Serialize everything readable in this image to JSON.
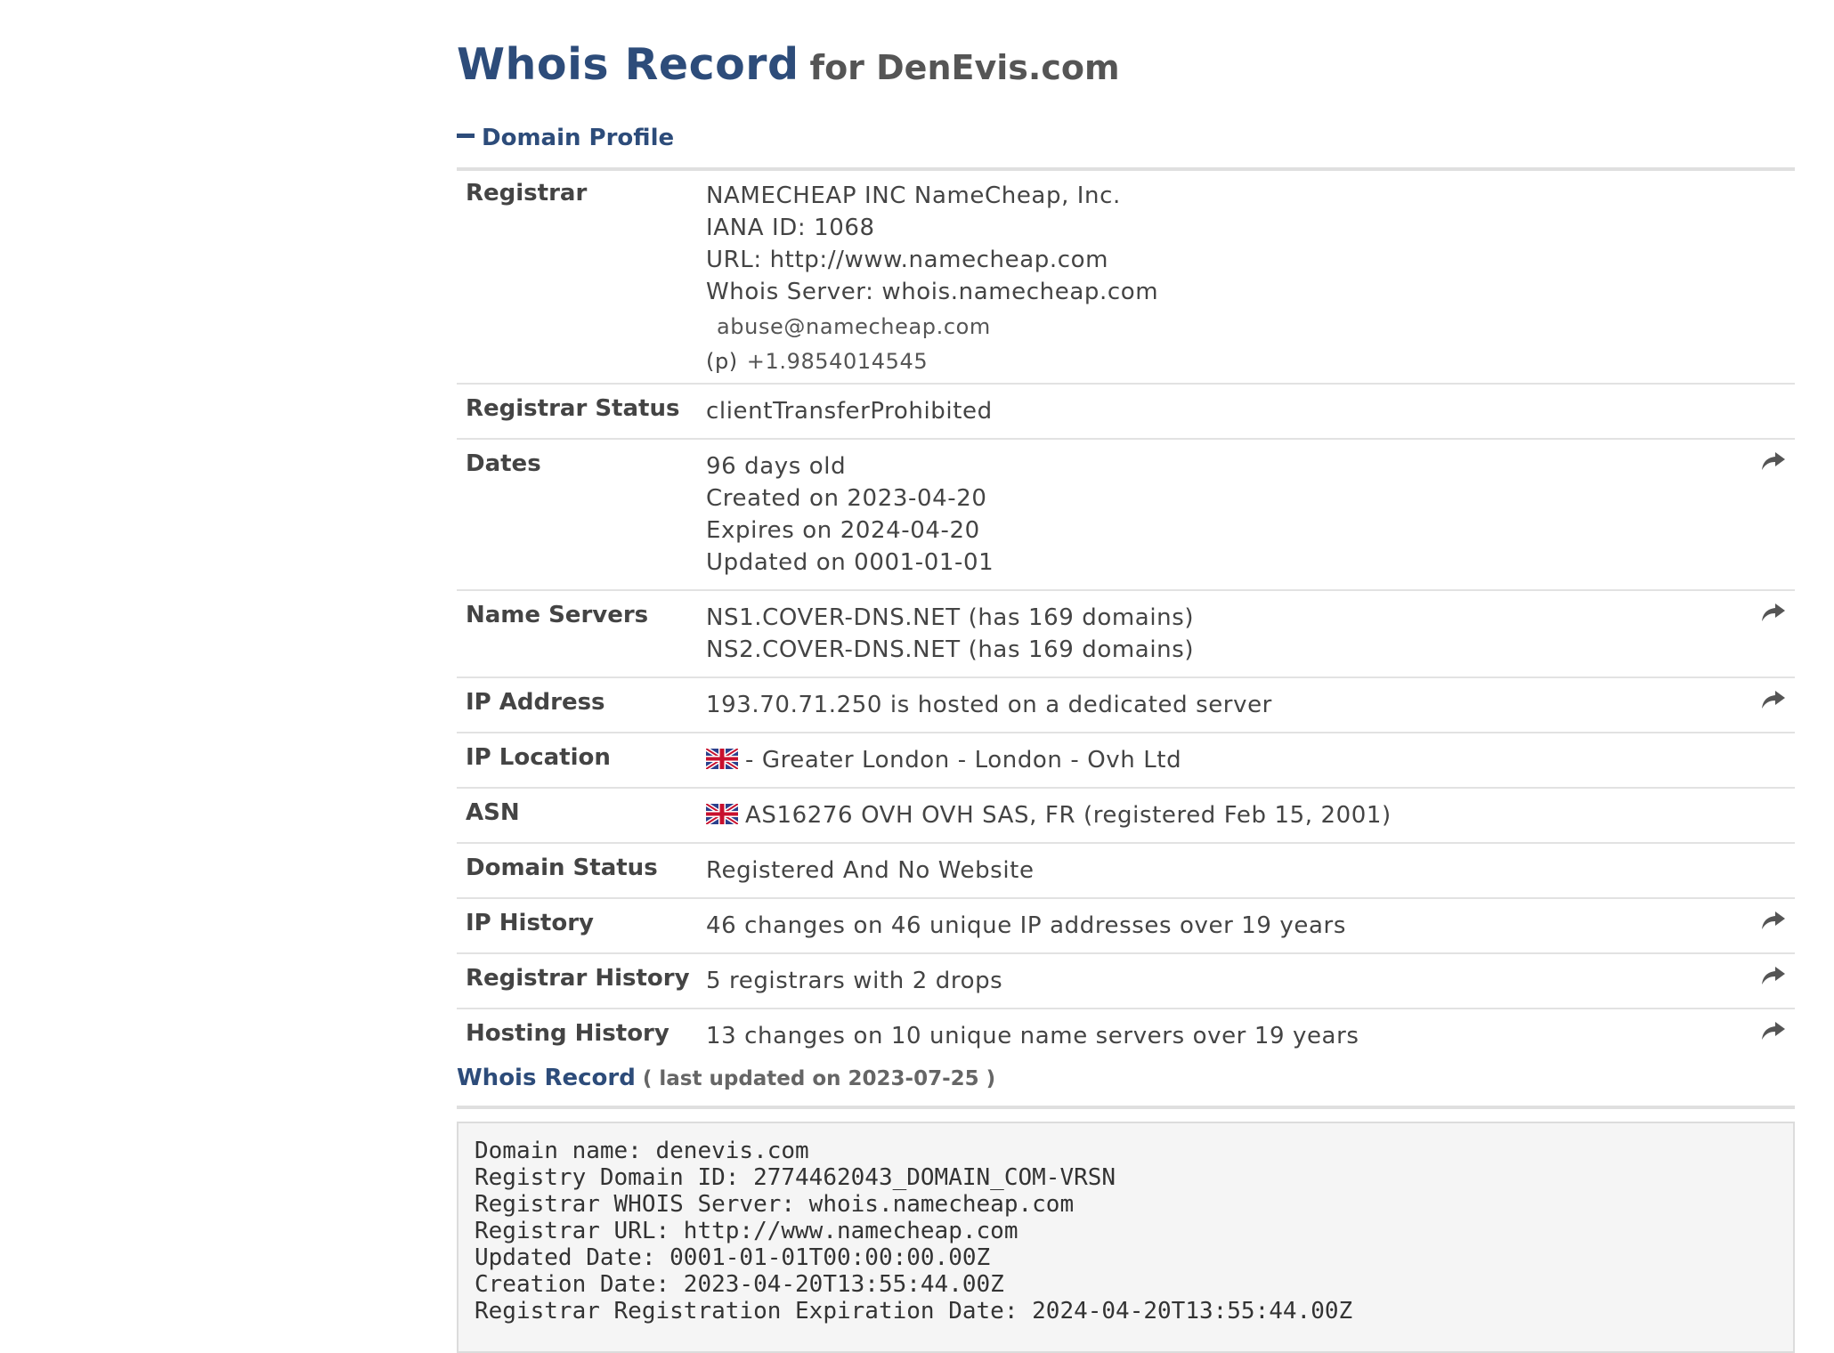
{
  "title": {
    "main": "Whois Record",
    "sub": "for DenEvis.com"
  },
  "profile_section": {
    "label": "Domain Profile"
  },
  "registrar": {
    "label": "Registrar",
    "lines": [
      "NAMECHEAP INC NameCheap, Inc.",
      "IANA ID: 1068",
      "URL: http://www.namecheap.com",
      "Whois Server: whois.namecheap.com"
    ],
    "email": "abuse@namecheap.com",
    "phone_prefix": "(p)",
    "phone": "+1.9854014545"
  },
  "registrar_status": {
    "label": "Registrar Status",
    "value": "clientTransferProhibited"
  },
  "dates": {
    "label": "Dates",
    "lines": [
      "96 days old",
      "Created on 2023-04-20",
      "Expires on 2024-04-20",
      "Updated on 0001-01-01"
    ]
  },
  "name_servers": {
    "label": "Name Servers",
    "lines": [
      "NS1.COVER-DNS.NET (has 169 domains)",
      "NS2.COVER-DNS.NET (has 169 domains)"
    ]
  },
  "ip_address": {
    "label": "IP Address",
    "value": "193.70.71.250 is hosted on a dedicated server"
  },
  "ip_location": {
    "label": "IP Location",
    "value": "- Greater London - London - Ovh Ltd"
  },
  "asn": {
    "label": "ASN",
    "value": "AS16276 OVH OVH SAS, FR (registered Feb 15, 2001)"
  },
  "domain_status": {
    "label": "Domain Status",
    "value": "Registered And No Website"
  },
  "ip_history": {
    "label": "IP History",
    "value": "46 changes on 46 unique IP addresses over 19 years"
  },
  "registrar_history": {
    "label": "Registrar History",
    "value": "5 registrars with 2 drops"
  },
  "hosting_history": {
    "label": "Hosting History",
    "value": "13 changes on 10 unique name servers over 19 years"
  },
  "record_section": {
    "label": "Whois Record",
    "updated": "( last updated on 2023-07-25 )"
  },
  "raw_record": "Domain name: denevis.com\nRegistry Domain ID: 2774462043_DOMAIN_COM-VRSN\nRegistrar WHOIS Server: whois.namecheap.com\nRegistrar URL: http://www.namecheap.com\nUpdated Date: 0001-01-01T00:00:00.00Z\nCreation Date: 2023-04-20T13:55:44.00Z\nRegistrar Registration Expiration Date: 2024-04-20T13:55:44.00Z",
  "colors": {
    "heading": "#2d4c7a",
    "text": "#444444",
    "divider": "#e2e2e2",
    "raw_bg": "#f5f5f5"
  },
  "icons": {
    "share": "share-arrow-icon",
    "flag": "uk-flag-icon",
    "collapse": "minus-icon"
  }
}
